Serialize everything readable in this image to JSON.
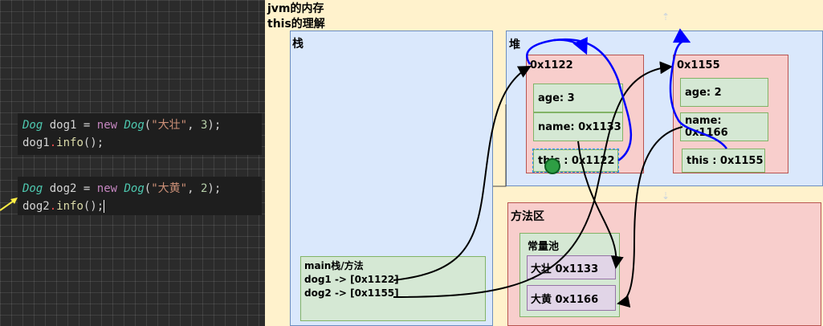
{
  "code": {
    "block1": {
      "line1": {
        "type": "Dog",
        "var": "dog1",
        "op": "=",
        "new": "new",
        "ctor": "Dog",
        "arg_str": "\"大壮\"",
        "arg_num": "3",
        "end": ");"
      },
      "line2": {
        "obj": "dog1",
        "dot": ".",
        "call": "info",
        "end": "();"
      }
    },
    "block2": {
      "line1": {
        "type": "Dog",
        "var": "dog2",
        "op": "=",
        "new": "new",
        "ctor": "Dog",
        "arg_str": "\"大黄\"",
        "arg_num": "2",
        "end": ");"
      },
      "line2": {
        "obj": "dog2",
        "dot": ".",
        "call": "info",
        "end": "();"
      }
    }
  },
  "diagram": {
    "title_line1": "jvm的内存",
    "title_line2": "this的理解",
    "stack_label": "栈",
    "heap_label": "堆",
    "method_area_label": "方法区",
    "objects": [
      {
        "address": "0x1122",
        "age": "age: 3",
        "name": "name: 0x1133",
        "this": "this : 0x1122"
      },
      {
        "address": "0x1155",
        "age": "age: 2",
        "name": "name: 0x1166",
        "this": "this : 0x1155"
      }
    ],
    "main_frame": {
      "title": "main栈/方法",
      "dog1": "dog1 -> [0x1122]",
      "dog2": "dog2 -> [0x1155]"
    },
    "constant_pool": {
      "label": "常量池",
      "items": [
        "大壮 0x1133",
        "大黄 0x1166"
      ]
    }
  },
  "colors": {
    "canvas_bg": "#fff2cc",
    "region_blue": "#dae8fc",
    "object_red": "#f8cecc",
    "field_green": "#d5e8d4",
    "pool_item_purple": "#e1d5e7",
    "this_arrow": "#0000ff",
    "ref_arrow": "#000000"
  }
}
